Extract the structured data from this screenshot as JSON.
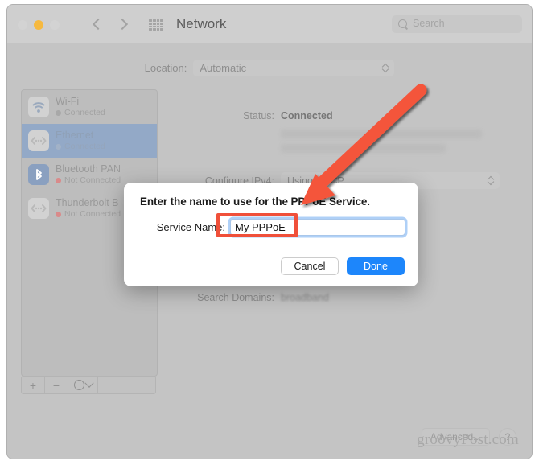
{
  "window": {
    "title": "Network",
    "traffic_lights": [
      "close-button",
      "minimize-button",
      "zoom-button"
    ],
    "nav": {
      "back": "back-chevron-icon",
      "forward": "forward-chevron-icon",
      "grid": "all-preferences-grid-icon"
    },
    "search": {
      "placeholder": "Search",
      "value": "",
      "icon": "search-icon"
    }
  },
  "location": {
    "label": "Location:",
    "value": "Automatic"
  },
  "sidebar": {
    "items": [
      {
        "name": "Wi-Fi",
        "status": "Connected",
        "icon": "wifi-icon",
        "state": "connected",
        "selected": false
      },
      {
        "name": "Ethernet",
        "status": "Connected",
        "icon": "ethernet-icon",
        "state": "connected",
        "selected": true
      },
      {
        "name": "Bluetooth PAN",
        "status": "Not Connected",
        "icon": "bluetooth-icon",
        "state": "not-connected",
        "selected": false
      },
      {
        "name": "Thunderbolt B",
        "status": "Not Connected",
        "icon": "thunderbolt-icon",
        "state": "not-connected",
        "selected": false
      }
    ],
    "toolbar": {
      "add": "+",
      "remove": "−",
      "actions": "action-menu-icon"
    }
  },
  "detail": {
    "status_label": "Status:",
    "status_value": "Connected",
    "configure_label": "Configure IPv4:",
    "configure_value": "Using DHCP",
    "search_domains_label": "Search Domains:",
    "search_domains_value": "broadband"
  },
  "footer": {
    "advanced_label": "Advanced...",
    "help_label": "?"
  },
  "watermark": "groovyPost.com",
  "dialog": {
    "title": "Enter the name to use for the PPPoE Service.",
    "field_label": "Service Name:",
    "field_value": "My PPPoE",
    "field_placeholder": "",
    "cancel_label": "Cancel",
    "done_label": "Done"
  },
  "annotations": {
    "arrow_color": "#f4543b",
    "box_color": "#f0503a",
    "arrow_name": "red-pointer-arrow",
    "box_name": "red-highlight-box"
  }
}
